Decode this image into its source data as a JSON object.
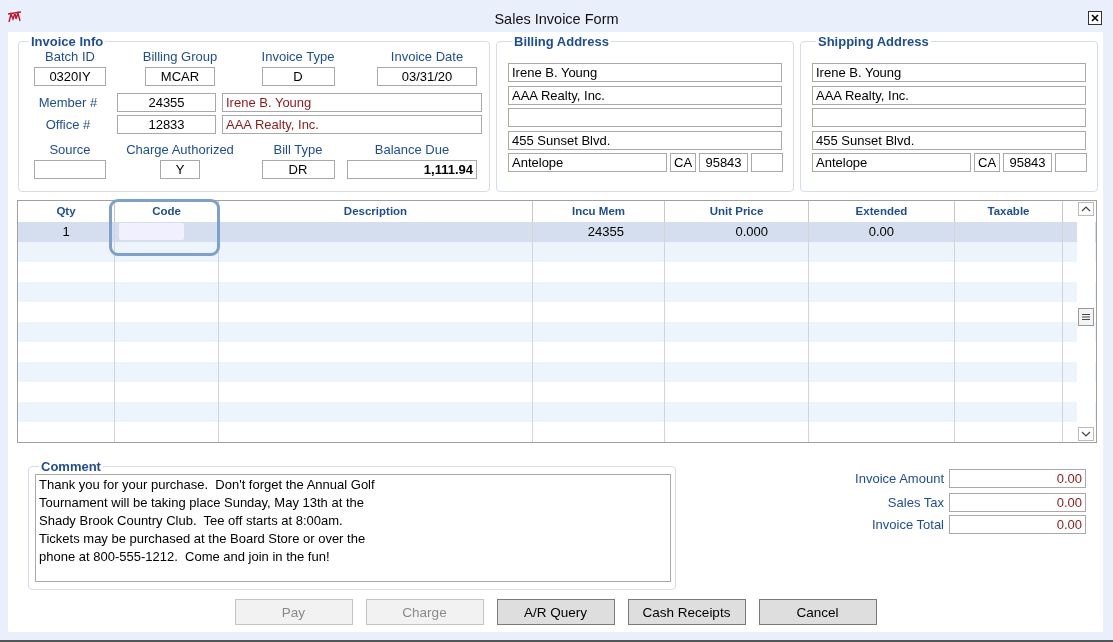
{
  "window": {
    "title": "Sales Invoice Form"
  },
  "invoice_info": {
    "title": "Invoice Info",
    "top": [
      {
        "label": "Batch ID",
        "value": "0320IY"
      },
      {
        "label": "Billing Group",
        "value": "MCAR"
      },
      {
        "label": "Invoice Type",
        "value": "D"
      },
      {
        "label": "Invoice Date",
        "value": "03/31/20"
      }
    ],
    "member": {
      "label": "Member #",
      "number": "24355",
      "name": "Irene B. Young"
    },
    "office": {
      "label": "Office #",
      "number": "12833",
      "name": "AAA Realty, Inc."
    },
    "bottom": [
      {
        "label": "Source"
      },
      {
        "label": "Charge Authorized",
        "value": "Y",
        "bold": false
      },
      {
        "label": "Bill Type",
        "value": "DR",
        "bold": false
      },
      {
        "label": "Balance Due",
        "value": "1,111.94",
        "bold": true
      }
    ]
  },
  "billing_address": {
    "title": "Billing Address",
    "lines": [
      {
        "kind": "text",
        "value": "Irene B. Young"
      },
      {
        "kind": "text",
        "value": "AAA Realty, Inc."
      },
      {
        "kind": "blank"
      },
      {
        "kind": "text",
        "value": "455 Sunset Blvd."
      }
    ],
    "city": "Antelope",
    "state": "CA",
    "zip": "95843"
  },
  "shipping_address": {
    "title": "Shipping Address",
    "lines": [
      {
        "kind": "text",
        "value": "Irene B. Young"
      },
      {
        "kind": "text",
        "value": "AAA Realty, Inc."
      },
      {
        "kind": "blank"
      },
      {
        "kind": "text",
        "value": "455 Sunset Blvd."
      }
    ],
    "city": "Antelope",
    "state": "CA",
    "zip": "95843"
  },
  "grid": {
    "columns": [
      {
        "label": "Qty",
        "focused": false
      },
      {
        "label": "Code",
        "focused": true
      },
      {
        "label": "Description",
        "focused": false
      },
      {
        "label": "Incu Mem",
        "focused": false
      },
      {
        "label": "Unit Price",
        "focused": false
      },
      {
        "label": "Extended",
        "focused": false
      },
      {
        "label": "Taxable",
        "focused": false
      }
    ],
    "rows": [
      {
        "selected": true,
        "qty": "1",
        "incu_mem": "24355",
        "unit_price": "0.000",
        "extended": "0.00"
      }
    ]
  },
  "comment": {
    "title": "Comment",
    "text": "Thank you for your purchase.  Don't forget the Annual Golf\nTournament will be taking place Sunday, May 13th at the\nShady Brook Country Club.  Tee off starts at 8:00am.\nTickets may be purchased at the Board Store or over the\nphone at 800-555-1212.  Come and join in the fun!"
  },
  "totals": [
    {
      "label": "Invoice Amount",
      "value": "0.00"
    },
    {
      "label": "Sales Tax",
      "value": "0.00"
    },
    {
      "label": "Invoice Total",
      "value": "0.00"
    }
  ],
  "buttons": [
    {
      "label": "Pay",
      "disabled": true
    },
    {
      "label": "Charge",
      "disabled": true
    },
    {
      "label": "A/R Query",
      "disabled": false
    },
    {
      "label": "Cash Receipts",
      "disabled": false
    },
    {
      "label": "Cancel",
      "disabled": false
    }
  ]
}
